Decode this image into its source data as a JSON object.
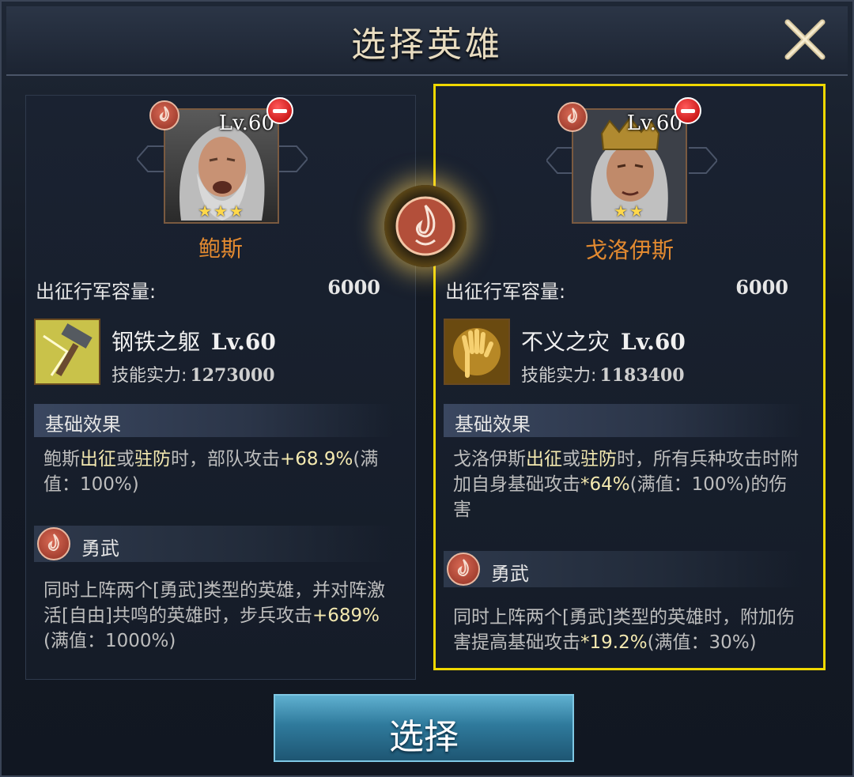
{
  "header": {
    "title": "选择英雄"
  },
  "button": {
    "select_label": "选择"
  },
  "heroes": [
    {
      "name": "鲍斯",
      "level": "Lv.60",
      "stars": "★★★",
      "capacity_label": "出征行军容量:",
      "capacity_value": "6000",
      "skill_name": "钢铁之躯",
      "skill_level": "Lv.60",
      "skill_power_label": "技能实力:",
      "skill_power_value": "1273000",
      "base_title": "基础效果",
      "base_effect": {
        "p1": "鲍斯",
        "k1": "出征",
        "p2": "或",
        "k2": "驻防",
        "p3": "时，部队攻击",
        "num": "+68.9%",
        "p4": "(满值：100%)"
      },
      "trait_title": "勇武",
      "trait_effect": {
        "p1": "同时上阵两个[勇武]类型的英雄，并对阵激活[自由]共鸣的英雄时，步兵攻击",
        "num": "+689%",
        "p2": "(满值：1000%)"
      }
    },
    {
      "name": "戈洛伊斯",
      "level": "Lv.60",
      "stars": "★★",
      "capacity_label": "出征行军容量:",
      "capacity_value": "6000",
      "skill_name": "不义之灾",
      "skill_level": "Lv.60",
      "skill_power_label": "技能实力:",
      "skill_power_value": "1183400",
      "base_title": "基础效果",
      "base_effect": {
        "p1": "戈洛伊斯",
        "k1": "出征",
        "p2": "或",
        "k2": "驻防",
        "p3": "时，所有兵种攻击时附加自身基础攻击",
        "num": "*64%",
        "p4": "(满值：100%)的伤害"
      },
      "trait_title": "勇武",
      "trait_effect": {
        "p1": "同时上阵两个[勇武]类型的英雄时，附加伤害提高基础攻击",
        "num": "*19.2%",
        "p2": "(满值：30%)"
      }
    }
  ],
  "colors": {
    "selected_border": "#f0d800",
    "hero_name": "#e38a30",
    "button": "#2f7a9c"
  }
}
